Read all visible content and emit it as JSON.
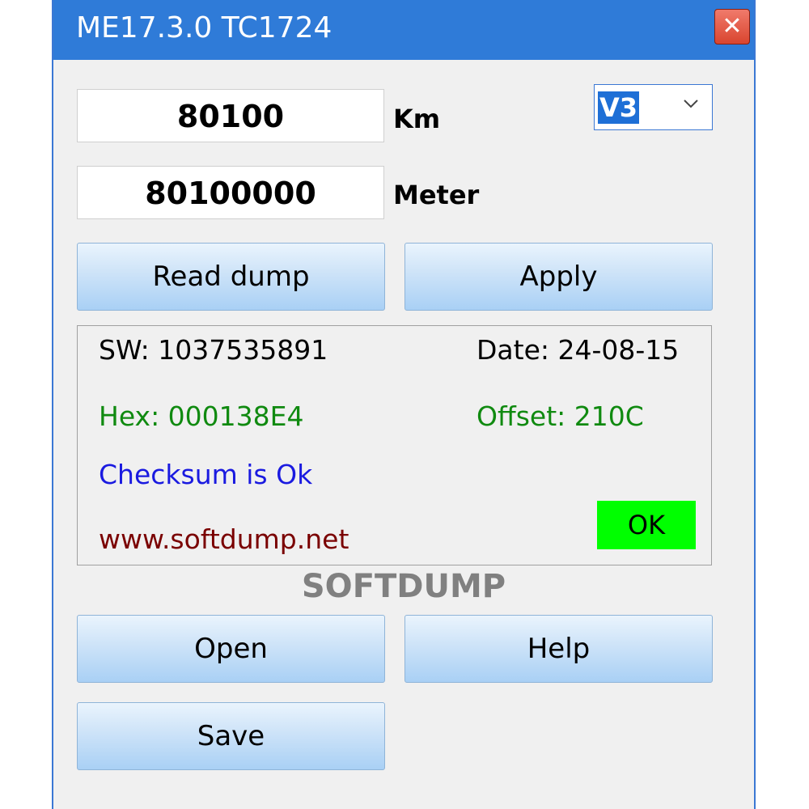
{
  "window": {
    "title": "ME17.3.0 TC1724",
    "close_icon": "close-icon"
  },
  "km": {
    "value": "80100",
    "unit": "Km"
  },
  "meter": {
    "value": "80100000",
    "unit": "Meter"
  },
  "version_select": {
    "selected": "V3"
  },
  "buttons": {
    "read_dump": "Read dump",
    "apply": "Apply",
    "open": "Open",
    "help": "Help",
    "save": "Save"
  },
  "info": {
    "sw": "SW: 1037535891",
    "date": "Date: 24-08-15",
    "hex": "Hex: 000138E4",
    "offset": "Offset: 210C",
    "checksum": "Checksum is Ok",
    "website": "www.softdump.net",
    "ok_label": "OK"
  },
  "brand": "SOFTDUMP",
  "colors": {
    "titlebar": "#2f7bd8",
    "hex_text": "#108a10",
    "checksum_text": "#1a1ae0",
    "website_text": "#7a0000",
    "ok_badge": "#00ff00"
  }
}
